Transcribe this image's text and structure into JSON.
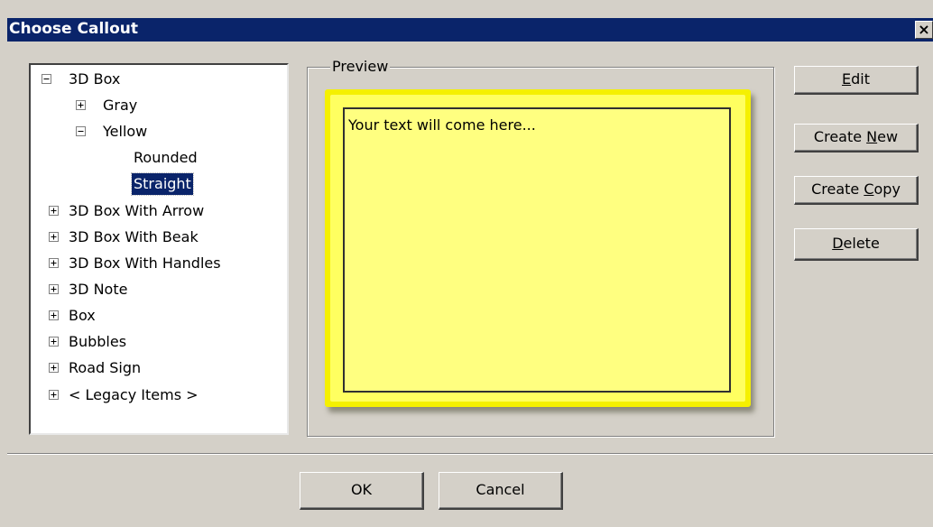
{
  "window": {
    "title": "Choose Callout",
    "close_glyph": "×"
  },
  "tree": {
    "items": [
      {
        "label": "3D Box",
        "expander": "minus"
      },
      {
        "label": "Gray",
        "expander": "plus"
      },
      {
        "label": "Yellow",
        "expander": "minus"
      },
      {
        "label": "Rounded",
        "expander": "none"
      },
      {
        "label": "Straight",
        "expander": "none",
        "selected": true
      },
      {
        "label": "3D Box With Arrow",
        "expander": "plus"
      },
      {
        "label": "3D Box With Beak",
        "expander": "plus"
      },
      {
        "label": "3D Box With Handles",
        "expander": "plus"
      },
      {
        "label": "3D Note",
        "expander": "plus"
      },
      {
        "label": "Box",
        "expander": "plus"
      },
      {
        "label": "Bubbles",
        "expander": "plus"
      },
      {
        "label": "Road Sign",
        "expander": "plus"
      },
      {
        "label": "< Legacy Items >",
        "expander": "plus"
      }
    ]
  },
  "preview": {
    "group_label": "Preview",
    "text": "Your text will come here...",
    "fill_color": "#ffff80",
    "border_color": "#303030",
    "glow_color": "#f5f000"
  },
  "buttons": {
    "edit": {
      "pre": "",
      "key": "E",
      "post": "dit"
    },
    "create_new": {
      "pre": "Create ",
      "key": "N",
      "post": "ew"
    },
    "create_copy": {
      "pre": "Create ",
      "key": "C",
      "post": "opy"
    },
    "delete": {
      "pre": "",
      "key": "D",
      "post": "elete"
    },
    "ok": "OK",
    "cancel": "Cancel"
  },
  "colors": {
    "title_bar": "#0a246a",
    "dialog_bg": "#d4d0c8",
    "selection": "#0a246a"
  }
}
